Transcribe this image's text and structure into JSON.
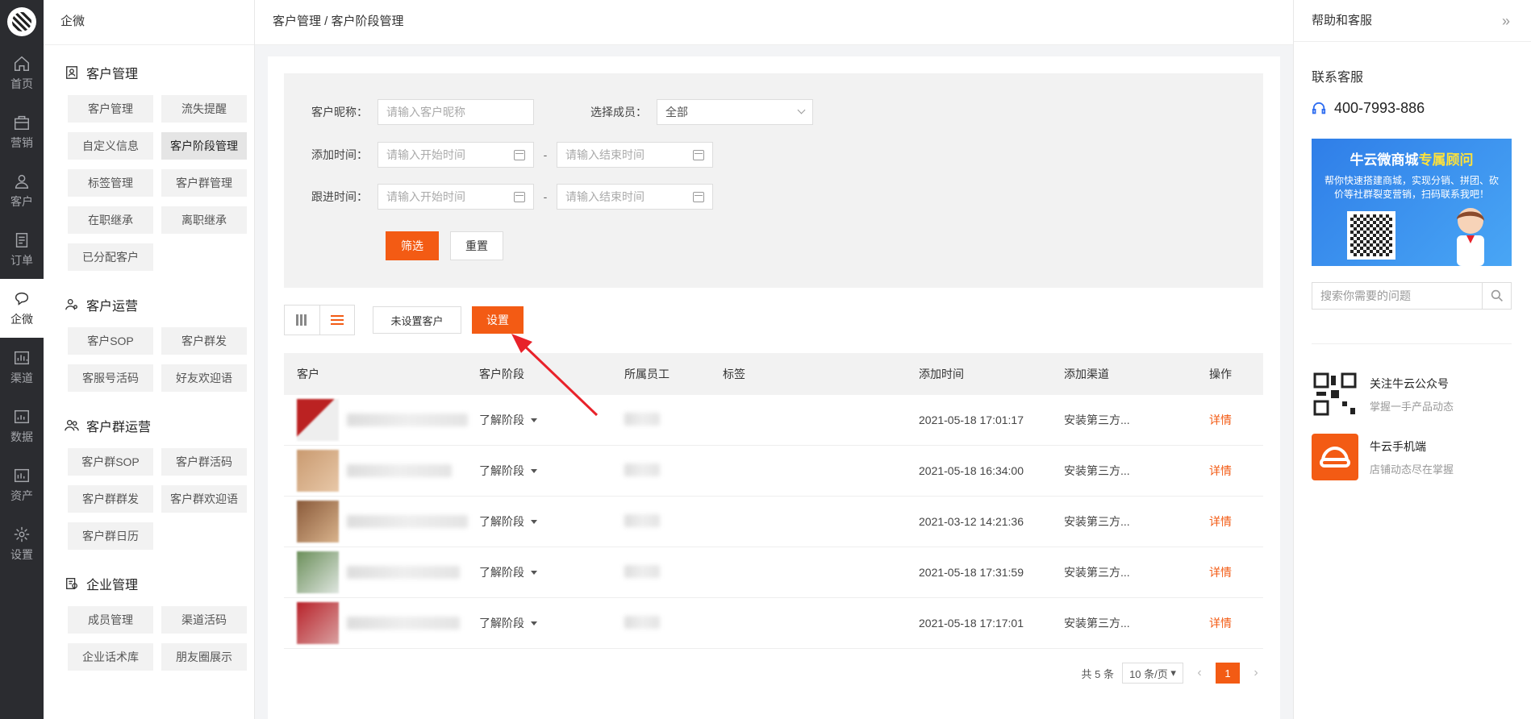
{
  "rail": [
    {
      "name": "home",
      "label": "首页"
    },
    {
      "name": "marketing",
      "label": "营销"
    },
    {
      "name": "customer",
      "label": "客户"
    },
    {
      "name": "order",
      "label": "订单"
    },
    {
      "name": "wecom",
      "label": "企微"
    },
    {
      "name": "channel",
      "label": "渠道"
    },
    {
      "name": "data",
      "label": "数据"
    },
    {
      "name": "assets",
      "label": "资产"
    },
    {
      "name": "settings",
      "label": "设置"
    }
  ],
  "sidebar": {
    "title": "企微",
    "sections": [
      {
        "title": "客户管理",
        "items": [
          "客户管理",
          "流失提醒",
          "自定义信息",
          "客户阶段管理",
          "标签管理",
          "客户群管理",
          "在职继承",
          "离职继承",
          "已分配客户"
        ]
      },
      {
        "title": "客户运营",
        "items": [
          "客户SOP",
          "客户群发",
          "客服号活码",
          "好友欢迎语"
        ]
      },
      {
        "title": "客户群运营",
        "items": [
          "客户群SOP",
          "客户群活码",
          "客户群群发",
          "客户群欢迎语",
          "客户群日历"
        ]
      },
      {
        "title": "企业管理",
        "items": [
          "成员管理",
          "渠道活码",
          "企业话术库",
          "朋友圈展示"
        ]
      }
    ],
    "active_item": "客户阶段管理"
  },
  "breadcrumb": "客户管理 / 客户阶段管理",
  "filter": {
    "nickname_label": "客户昵称：",
    "nickname_placeholder": "请输入客户昵称",
    "member_label": "选择成员：",
    "member_value": "全部",
    "add_time_label": "添加时间：",
    "follow_time_label": "跟进时间：",
    "start_placeholder": "请输入开始时间",
    "end_placeholder": "请输入结束时间",
    "dash": "-",
    "filter_button": "筛选",
    "reset_button": "重置"
  },
  "toolbar": {
    "unset_button": "未设置客户",
    "set_button": "设置"
  },
  "table": {
    "columns": [
      "客户",
      "客户阶段",
      "所属员工",
      "标签",
      "添加时间",
      "添加渠道",
      "操作"
    ],
    "rows": [
      {
        "stage": "了解阶段",
        "added": "2021-05-18 17:01:17",
        "channel": "安装第三方...",
        "action": "详情"
      },
      {
        "stage": "了解阶段",
        "added": "2021-05-18 16:34:00",
        "channel": "安装第三方...",
        "action": "详情"
      },
      {
        "stage": "了解阶段",
        "added": "2021-03-12 14:21:36",
        "channel": "安装第三方...",
        "action": "详情"
      },
      {
        "stage": "了解阶段",
        "added": "2021-05-18 17:31:59",
        "channel": "安装第三方...",
        "action": "详情"
      },
      {
        "stage": "了解阶段",
        "added": "2021-05-18 17:17:01",
        "channel": "安装第三方...",
        "action": "详情"
      }
    ]
  },
  "pager": {
    "total": "共 5 条",
    "page_size": "10 条/页",
    "current": "1"
  },
  "help": {
    "title": "帮助和客服",
    "contact_title": "联系客服",
    "phone": "400-7993-886",
    "banner_title_a": "牛云微商城",
    "banner_title_b": "专属顾问",
    "banner_text": "帮你快速搭建商城，实现分销、拼团、砍价等社群裂变营销，扫码联系我吧！",
    "search_placeholder": "搜索你需要的问题",
    "items": [
      {
        "title": "关注牛云公众号",
        "sub": "掌握一手产品动态"
      },
      {
        "title": "牛云手机端",
        "sub": "店铺动态尽在掌握"
      }
    ]
  },
  "colors": {
    "accent": "#f35b14",
    "rail_bg": "#2b2c30",
    "banner_blue": "#2f7ee8"
  }
}
